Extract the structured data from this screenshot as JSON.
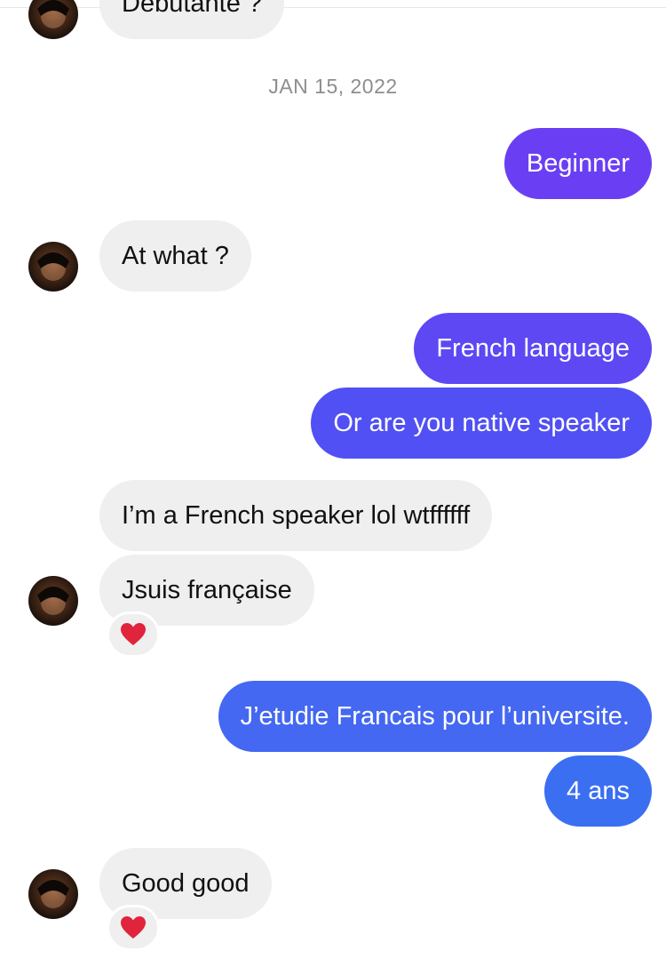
{
  "date_separator": "JAN 15, 2022",
  "messages": [
    {
      "from": "them",
      "text": "Débutante ?"
    },
    {
      "from": "me",
      "text": "Beginner"
    },
    {
      "from": "them",
      "text": "At what ?"
    },
    {
      "from": "me",
      "text": "French language"
    },
    {
      "from": "me",
      "text": "Or are you native speaker"
    },
    {
      "from": "them",
      "text": "I’m a French speaker lol wtffffff"
    },
    {
      "from": "them",
      "text": "Jsuis française",
      "reaction": "heart-emoji"
    },
    {
      "from": "me",
      "text": "J’etudie Francais pour l’universite."
    },
    {
      "from": "me",
      "text": "4 ans"
    },
    {
      "from": "them",
      "text": "Good good",
      "reaction": "heart-emoji"
    }
  ],
  "colors": {
    "incoming_bubble": "#efefef",
    "outgoing_gradient": [
      "#6a3ff3",
      "#3b6ff2"
    ],
    "date_text": "#8e8e8e",
    "reaction_heart": "#e0243b"
  },
  "icons": {
    "avatar": "profile-avatar",
    "reaction": "heart-emoji"
  }
}
